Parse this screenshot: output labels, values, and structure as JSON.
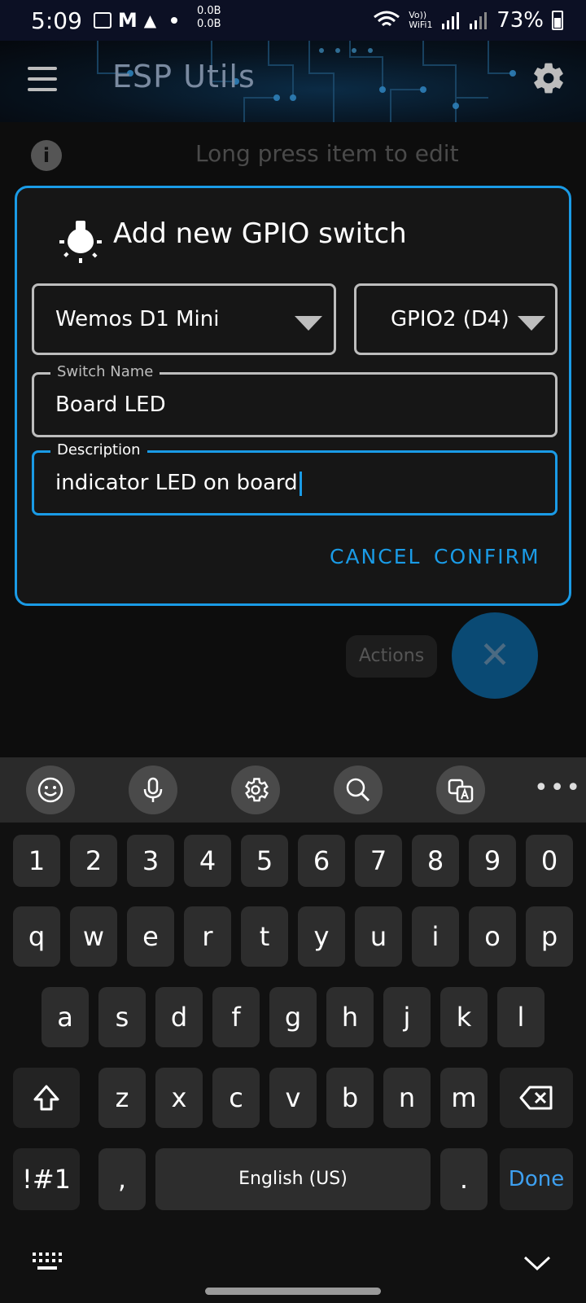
{
  "status_bar": {
    "time": "5:09",
    "net_up": "0.0B",
    "net_down": "0.0B",
    "network": "Vo)) WiFi1",
    "battery": "73%"
  },
  "app_bar": {
    "title": "ESP Utils"
  },
  "background": {
    "hint": "Long press item to edit",
    "actions_label": "Actions",
    "fab_symbol": "✕"
  },
  "dialog": {
    "title": "Add new GPIO switch",
    "board_select": "Wemos D1 Mini",
    "gpio_select": "GPIO2 (D4)",
    "switch_name_label": "Switch Name",
    "switch_name_value": "Board LED",
    "description_label": "Description",
    "description_value": "indicator LED on board",
    "cancel_label": "CANCEL",
    "confirm_label": "CONFIRM",
    "accent_color": "#1a9be6"
  },
  "keyboard": {
    "toolbar_icons": [
      "emoji-icon",
      "microphone-icon",
      "settings-icon",
      "search-icon",
      "translate-icon",
      "more-icon"
    ],
    "more_label": "•••",
    "row_numbers": [
      "1",
      "2",
      "3",
      "4",
      "5",
      "6",
      "7",
      "8",
      "9",
      "0"
    ],
    "row_q": [
      "q",
      "w",
      "e",
      "r",
      "t",
      "y",
      "u",
      "i",
      "o",
      "p"
    ],
    "row_a": [
      "a",
      "s",
      "d",
      "f",
      "g",
      "h",
      "j",
      "k",
      "l"
    ],
    "row_z": [
      "z",
      "x",
      "c",
      "v",
      "b",
      "n",
      "m"
    ],
    "symbols_label": "!#1",
    "comma_label": ",",
    "space_label": "English (US)",
    "period_label": ".",
    "done_label": "Done"
  }
}
